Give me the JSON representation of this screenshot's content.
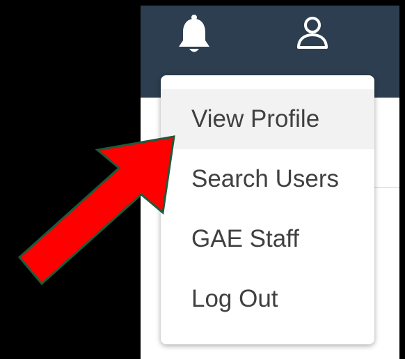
{
  "navbar": {
    "background": "#2d3e50",
    "icons": [
      "bell-icon",
      "user-icon"
    ]
  },
  "menu": {
    "items": [
      {
        "label": "View Profile",
        "highlighted": true
      },
      {
        "label": "Search Users"
      },
      {
        "label": "GAE Staff"
      },
      {
        "label": "Log Out"
      }
    ],
    "highlight_color": "#f2f2f2",
    "text_color": "#404040"
  },
  "annotation": {
    "arrow_color": "#ff0000",
    "arrow_outline": "#1e5a3a",
    "points_to": "View Profile"
  }
}
